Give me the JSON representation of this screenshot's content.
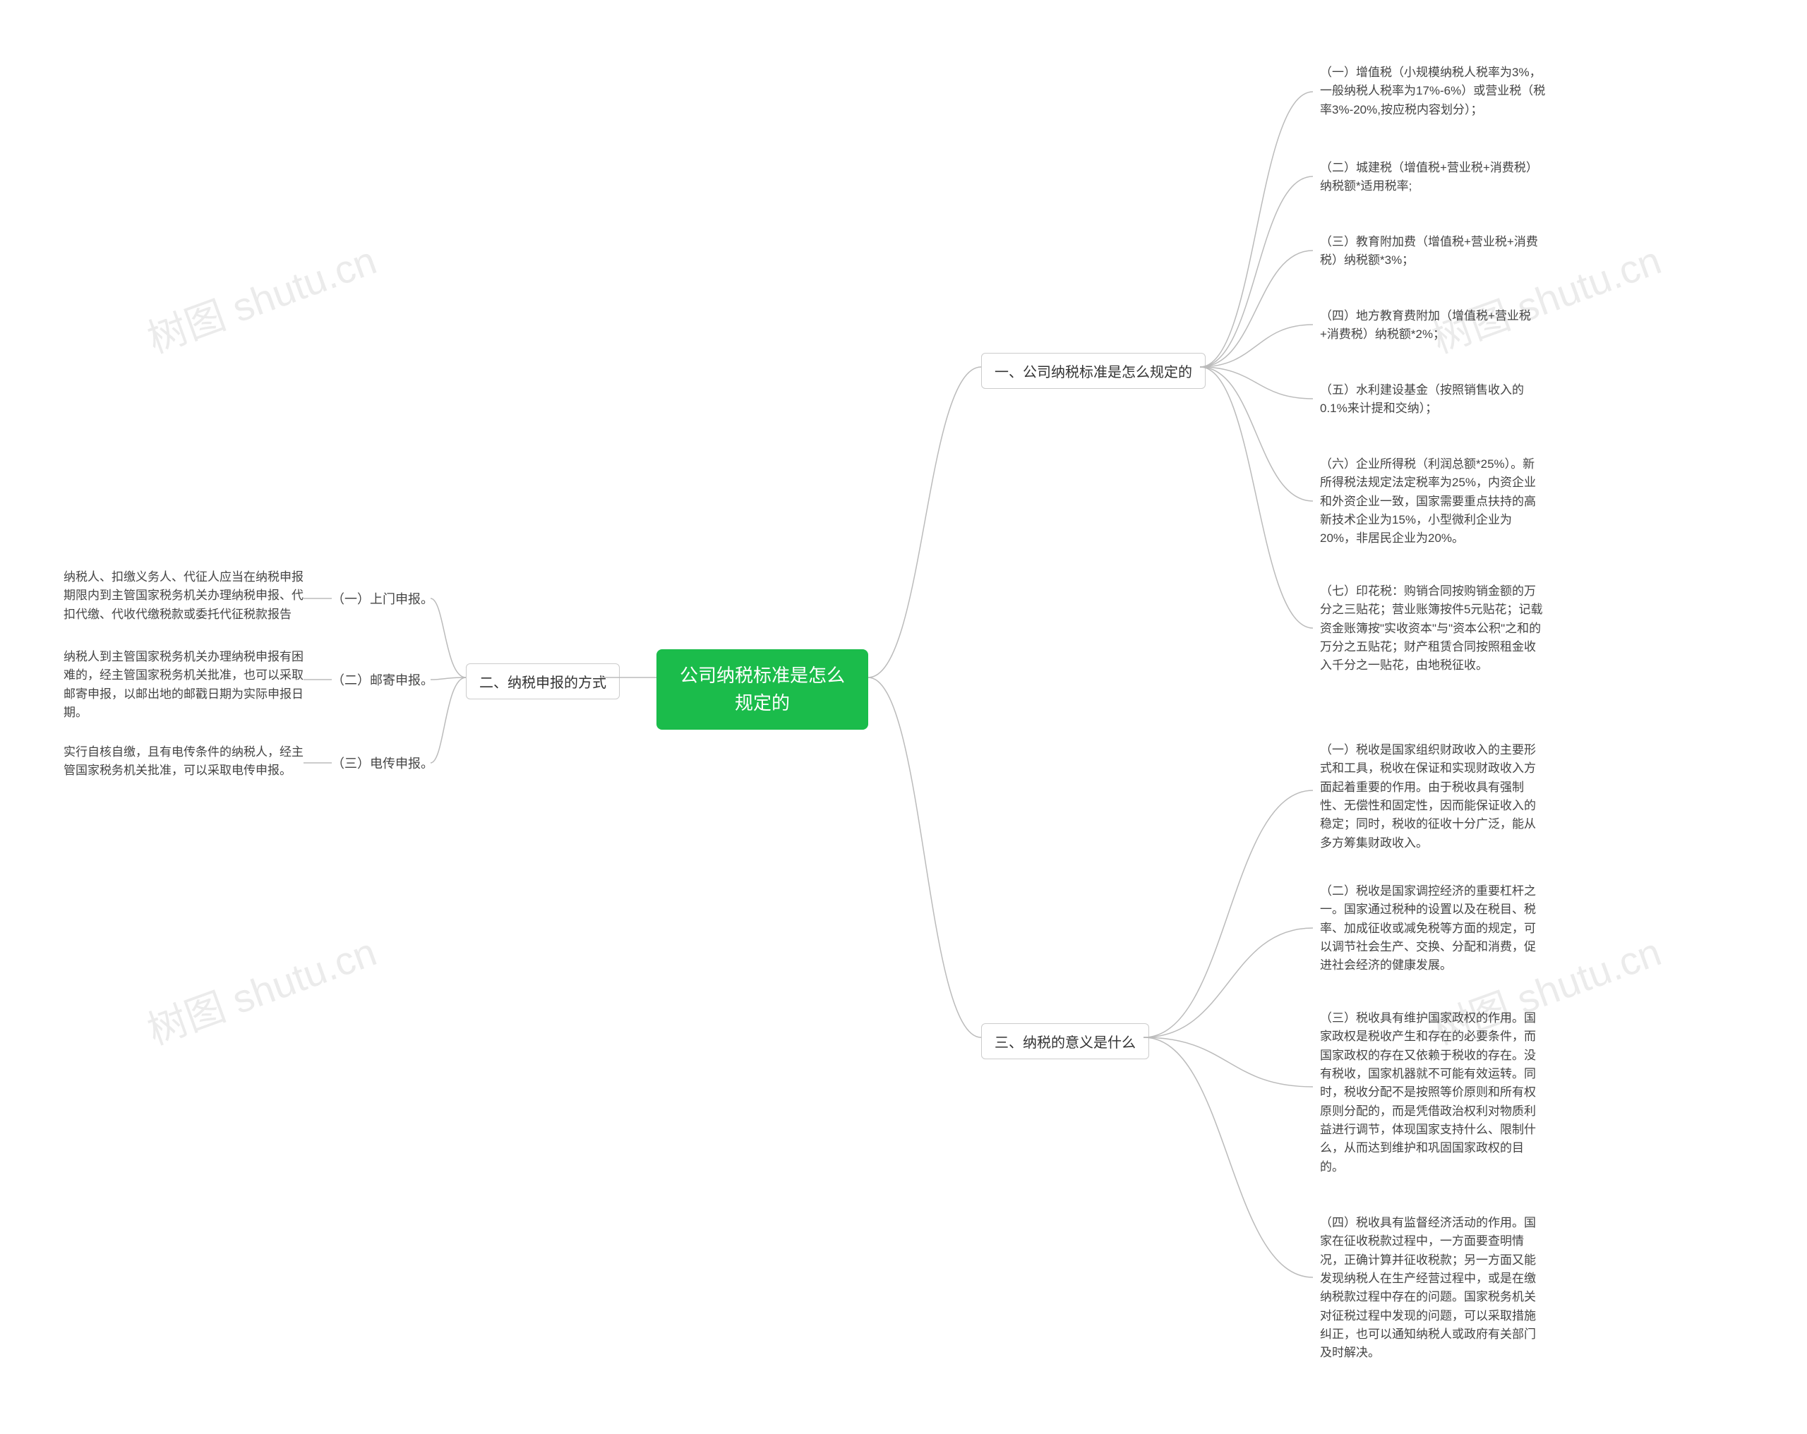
{
  "center": {
    "title": "公司纳税标准是怎么规定的"
  },
  "watermarks": [
    "树图 shutu.cn",
    "树图 shutu.cn",
    "树图 shutu.cn",
    "树图 shutu.cn"
  ],
  "right": {
    "branch1": {
      "label": "一、公司纳税标准是怎么规定的",
      "items": [
        "（一）增值税（小规模纳税人税率为3%，一般纳税人税率为17%-6%）或营业税（税率3%-20%,按应税内容划分）；",
        "（二）城建税（增值税+营业税+消费税）纳税额*适用税率;",
        "（三）教育附加费（增值税+营业税+消费税）纳税额*3%；",
        "（四）地方教育费附加（增值税+营业税+消费税）纳税额*2%；",
        "（五）水利建设基金（按照销售收入的0.1%来计提和交纳）；",
        "（六）企业所得税（利润总额*25%）。新所得税法规定法定税率为25%，内资企业和外资企业一致，国家需要重点扶持的高新技术企业为15%，小型微利企业为20%，非居民企业为20%。",
        "（七）印花税：购销合同按购销金额的万分之三贴花；营业账簿按件5元贴花；记载资金账簿按\"实收资本\"与\"资本公积\"之和的万分之五贴花；财产租赁合同按照租金收入千分之一贴花，由地税征收。"
      ]
    },
    "branch3": {
      "label": "三、纳税的意义是什么",
      "items": [
        "（一）税收是国家组织财政收入的主要形式和工具，税收在保证和实现财政收入方面起着重要的作用。由于税收具有强制性、无偿性和固定性，因而能保证收入的稳定；同时，税收的征收十分广泛，能从多方筹集财政收入。",
        "（二）税收是国家调控经济的重要杠杆之一。国家通过税种的设置以及在税目、税率、加成征收或减免税等方面的规定，可以调节社会生产、交换、分配和消费，促进社会经济的健康发展。",
        "（三）税收具有维护国家政权的作用。国家政权是税收产生和存在的必要条件，而国家政权的存在又依赖于税收的存在。没有税收，国家机器就不可能有效运转。同时，税收分配不是按照等价原则和所有权原则分配的，而是凭借政治权利对物质利益进行调节，体现国家支持什么、限制什么，从而达到维护和巩固国家政权的目的。",
        "（四）税收具有监督经济活动的作用。国家在征收税款过程中，一方面要查明情况，正确计算并征收税款；另一方面又能发现纳税人在生产经营过程中，或是在缴纳税款过程中存在的问题。国家税务机关对征税过程中发现的问题，可以采取措施纠正，也可以通知纳税人或政府有关部门及时解决。"
      ]
    }
  },
  "left": {
    "branch2": {
      "label": "二、纳税申报的方式",
      "subs": [
        {
          "label": "（一）上门申报。",
          "desc": "纳税人、扣缴义务人、代征人应当在纳税申报期限内到主管国家税务机关办理纳税申报、代扣代缴、代收代缴税款或委托代征税款报告"
        },
        {
          "label": "（二）邮寄申报。",
          "desc": "纳税人到主管国家税务机关办理纳税申报有困难的，经主管国家税务机关批准，也可以采取邮寄申报，以邮出地的邮戳日期为实际申报日期。"
        },
        {
          "label": "（三）电传申报。",
          "desc": "实行自核自缴，且有电传条件的纳税人，经主管国家税务机关批准，可以采取电传申报。"
        }
      ]
    }
  }
}
